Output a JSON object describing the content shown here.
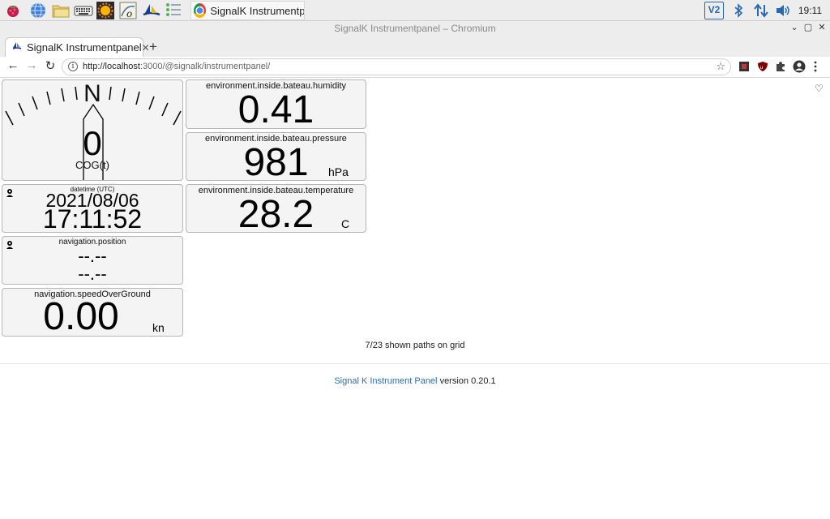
{
  "taskbar": {
    "task_label": "SignalK Instrumentpa...",
    "clock": "19:11",
    "tray_vnc_label": "V2"
  },
  "window": {
    "title": "SignalK Instrumentpanel – Chromium"
  },
  "tab": {
    "label": "SignalK Instrumentpanel",
    "close": "✕",
    "new_tab": "+"
  },
  "toolbar": {
    "url_host": "http://localhost",
    "url_rest": ":3000/@signalk/instrumentpanel/"
  },
  "panels": {
    "compass": {
      "heading_letter": "N",
      "value": "0",
      "label": "COG(t)"
    },
    "datetime": {
      "label": "datetime (UTC)",
      "date": "2021/08/06",
      "time": "17:11:52"
    },
    "position": {
      "label": "navigation.position",
      "lat": "--.--",
      "lon": "--.--"
    },
    "speed": {
      "label": "navigation.speedOverGround",
      "value": "0.00",
      "unit": "kn"
    },
    "humidity": {
      "label": "environment.inside.bateau.humidity",
      "value": "0.41"
    },
    "pressure": {
      "label": "environment.inside.bateau.pressure",
      "value": "981",
      "unit": "hPa"
    },
    "temperature": {
      "label": "environment.inside.bateau.temperature",
      "value": "28.2",
      "unit": "C"
    }
  },
  "grid_info": "7/23 shown paths on grid",
  "footer": {
    "link": "Signal K Instrument Panel",
    "version": "version 0.20.1"
  },
  "colors": {
    "accent_link": "#2a6fb4",
    "panel_bg": "#f4f4f4"
  }
}
